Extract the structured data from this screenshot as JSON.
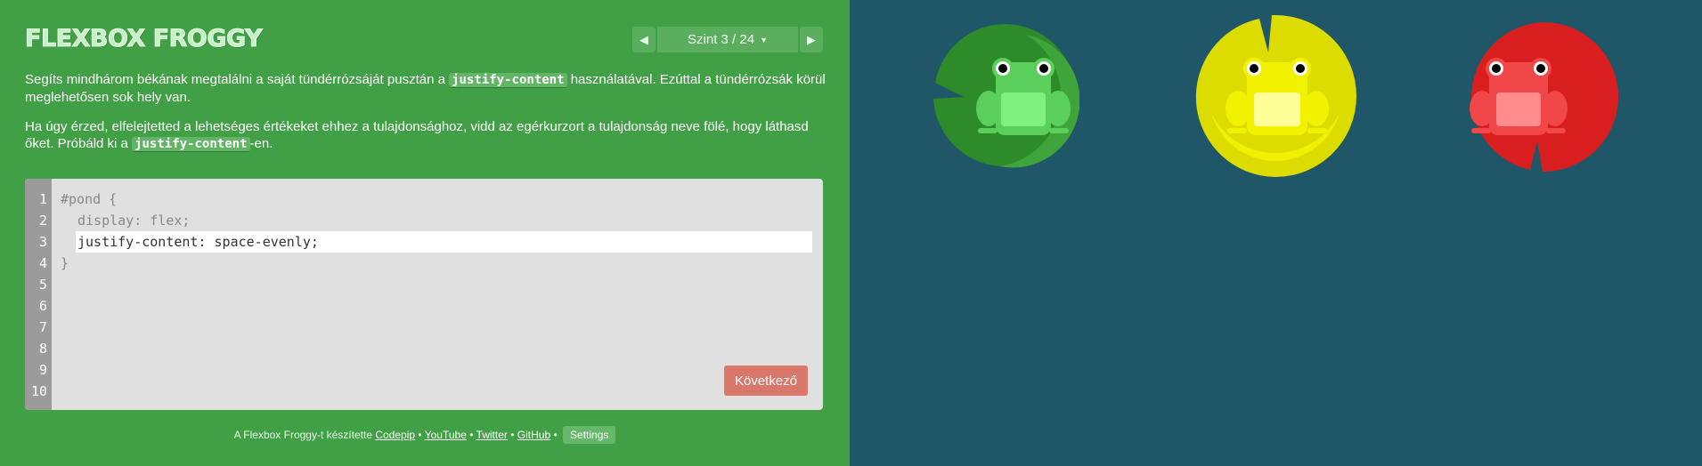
{
  "header": {
    "title": "FLEXBOX FROGGY",
    "level_label": "Szint 3 / 24",
    "prev_icon": "triangle-left-icon",
    "next_icon": "triangle-right-icon",
    "dropdown_icon": "caret-down-icon"
  },
  "instructions": {
    "p1_before": "Segíts mindhárom békának megtalálni a saját tündérrózsáját pusztán a ",
    "p1_code": "justify-content",
    "p1_after": " használatával. Ezúttal a tündérrózsák körül meglehetősen sok hely van.",
    "p2_before": "Ha úgy érzed, elfelejtetted a lehetséges értékeket ehhez a tulajdonsághoz, vidd az egérkurzort a tulajdonság neve fölé, hogy láthasd őket. Próbáld ki a ",
    "p2_code": "justify-content",
    "p2_after": "-en."
  },
  "editor": {
    "line_numbers": [
      "1",
      "2",
      "3",
      "4",
      "5",
      "6",
      "7",
      "8",
      "9",
      "10"
    ],
    "line1": "#pond {",
    "line2": "display: flex;",
    "input_value": "justify-content: space-evenly;",
    "line4": "}",
    "next_button": "Következő"
  },
  "footer": {
    "prefix": "A Flexbox Froggy-t készítette",
    "links": [
      "Codepip",
      "YouTube",
      "Twitter",
      "GitHub"
    ],
    "separator": "•",
    "settings": "Settings"
  },
  "pond": {
    "colors": {
      "green": "#2e8b2a",
      "yellow": "#d4d400",
      "red": "#d81e1e",
      "background": "#1f5768",
      "sidebar": "#41a045"
    },
    "frogs": [
      {
        "color": "green",
        "icon": "frog-icon"
      },
      {
        "color": "yellow",
        "icon": "frog-icon"
      },
      {
        "color": "red",
        "icon": "frog-icon"
      }
    ],
    "lilypads": [
      {
        "color": "green",
        "icon": "lilypad-icon"
      },
      {
        "color": "yellow",
        "icon": "lilypad-icon"
      },
      {
        "color": "red",
        "icon": "lilypad-icon"
      }
    ]
  }
}
